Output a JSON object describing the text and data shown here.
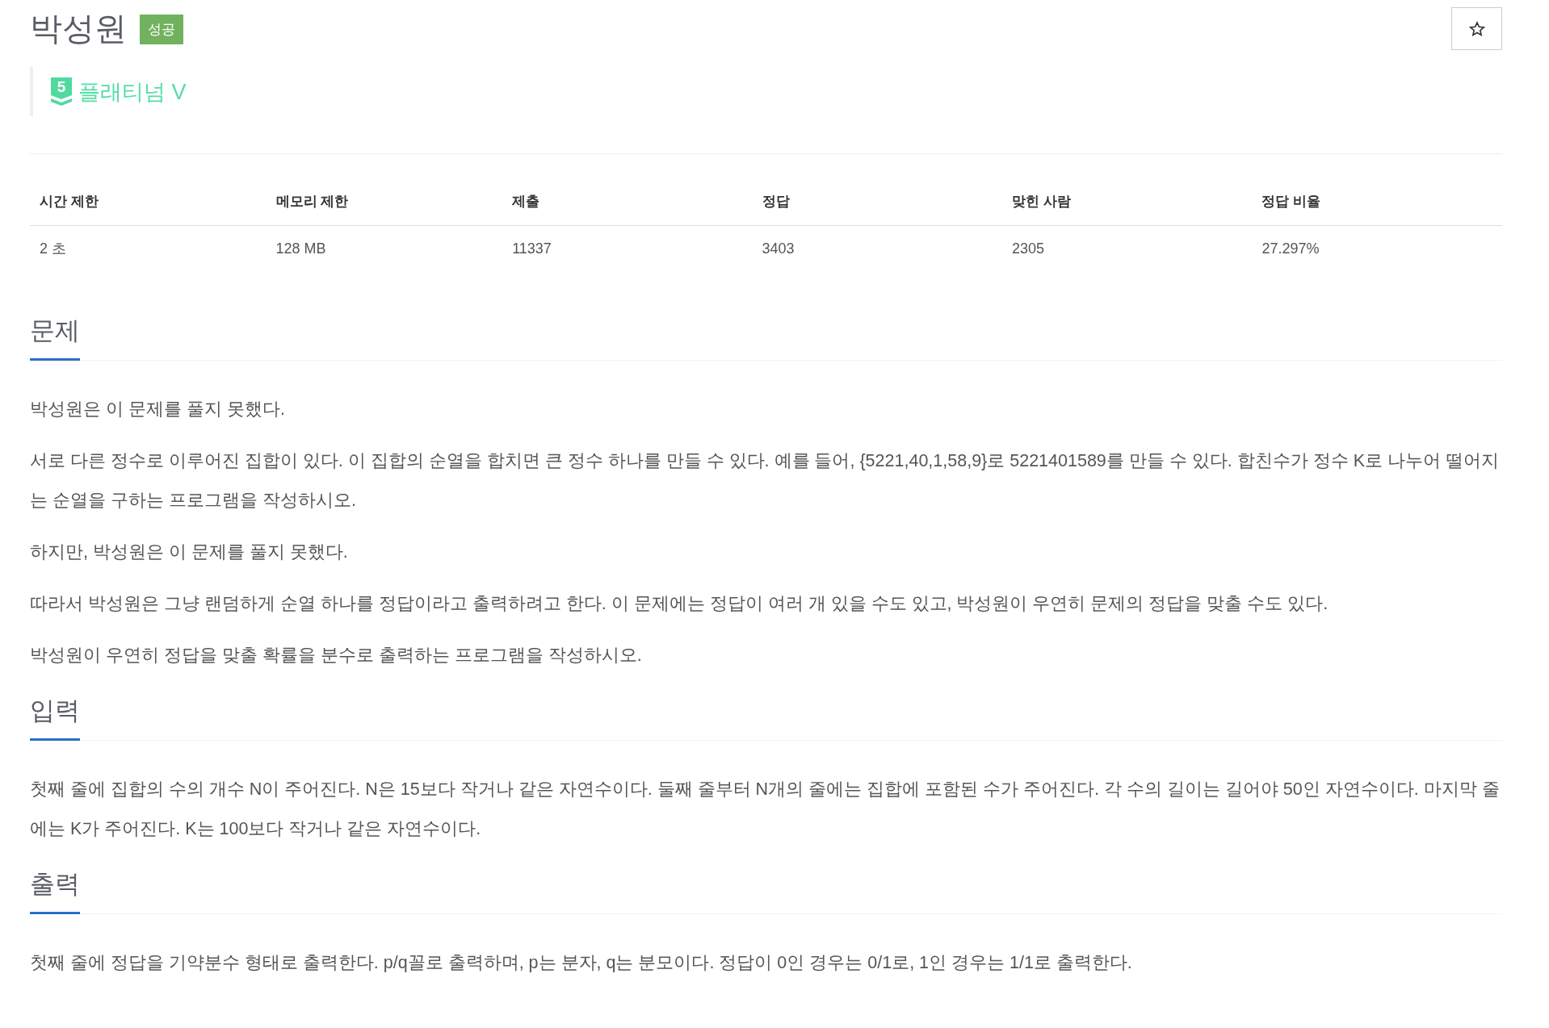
{
  "problem": {
    "title": "박성원",
    "result_badge": "성공"
  },
  "tier": {
    "badge_number": "5",
    "name": "플래티넘 V"
  },
  "stats": {
    "columns": [
      "시간 제한",
      "메모리 제한",
      "제출",
      "정답",
      "맞힌 사람",
      "정답 비율"
    ],
    "rows": [
      [
        "2 초",
        "128 MB",
        "11337",
        "3403",
        "2305",
        "27.297%"
      ]
    ]
  },
  "sections": [
    {
      "heading": "문제",
      "paragraphs": [
        "박성원은 이 문제를 풀지 못했다.",
        "서로 다른 정수로 이루어진 집합이 있다. 이 집합의 순열을 합치면 큰 정수 하나를 만들 수 있다. 예를 들어, {5221,40,1,58,9}로 5221401589를 만들 수 있다. 합친수가 정수 K로 나누어 떨어지는 순열을 구하는 프로그램을 작성하시오.",
        "하지만, 박성원은 이 문제를 풀지 못했다.",
        "따라서 박성원은 그냥 랜덤하게 순열 하나를 정답이라고 출력하려고 한다. 이 문제에는 정답이 여러 개 있을 수도 있고, 박성원이 우연히 문제의 정답을 맞출 수도 있다.",
        "박성원이 우연히 정답을 맞출 확률을 분수로 출력하는 프로그램을 작성하시오."
      ]
    },
    {
      "heading": "입력",
      "paragraphs": [
        "첫째 줄에 집합의 수의 개수 N이 주어진다. N은 15보다 작거나 같은 자연수이다. 둘째 줄부터 N개의 줄에는 집합에 포함된 수가 주어진다. 각 수의 길이는 길어야 50인 자연수이다. 마지막 줄에는 K가 주어진다. K는 100보다 작거나 같은 자연수이다."
      ]
    },
    {
      "heading": "출력",
      "paragraphs": [
        "첫째 줄에 정답을 기약분수 형태로 출력한다. p/q꼴로 출력하며, p는 분자, q는 분모이다. 정답이 0인 경우는 0/1로, 1인 경우는 1/1로 출력한다."
      ]
    }
  ]
}
